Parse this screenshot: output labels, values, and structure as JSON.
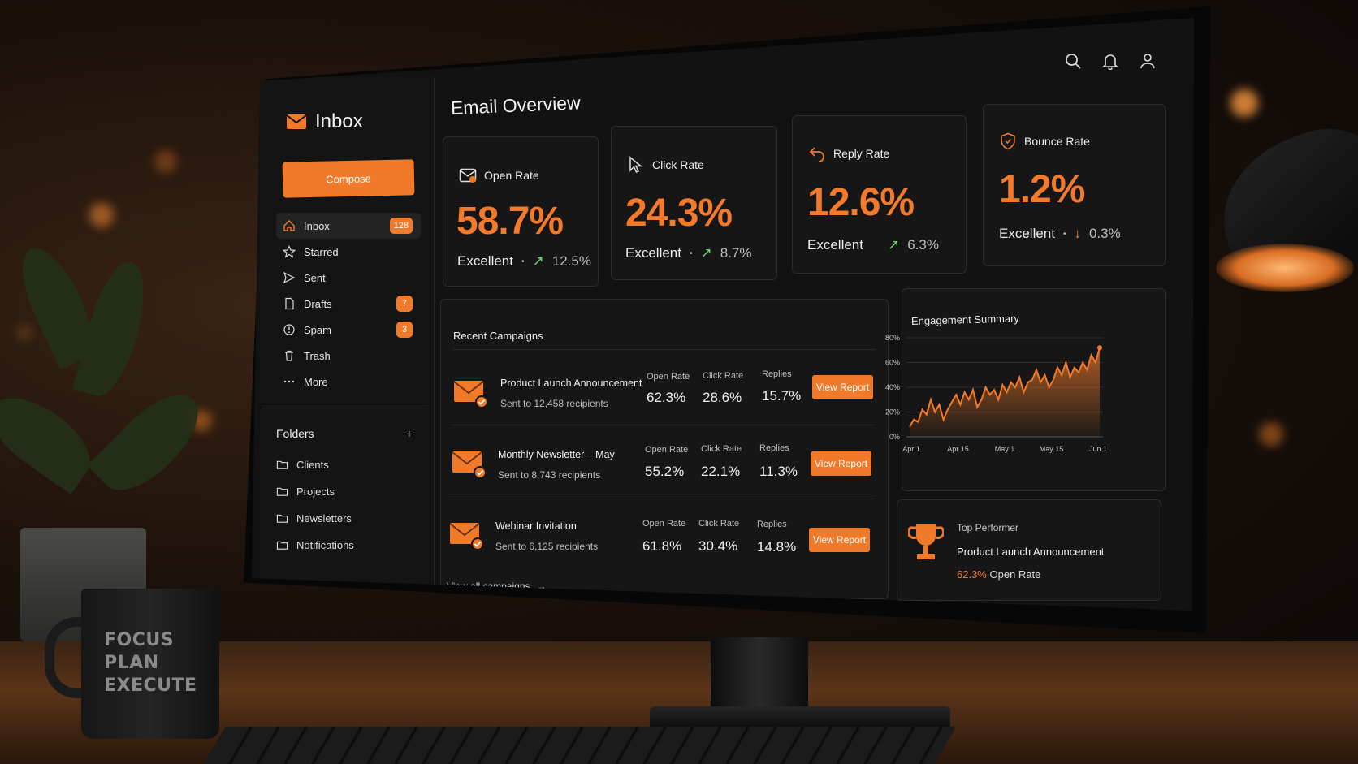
{
  "sidebar": {
    "title": "Inbox",
    "compose_label": "Compose",
    "nav": [
      {
        "label": "Inbox",
        "icon": "home-icon",
        "badge": "128"
      },
      {
        "label": "Starred",
        "icon": "star-icon",
        "badge": ""
      },
      {
        "label": "Sent",
        "icon": "send-icon",
        "badge": ""
      },
      {
        "label": "Drafts",
        "icon": "file-icon",
        "badge": "7"
      },
      {
        "label": "Spam",
        "icon": "alert-icon",
        "badge": "3"
      },
      {
        "label": "Trash",
        "icon": "trash-icon",
        "badge": ""
      },
      {
        "label": "More",
        "icon": "more-icon",
        "badge": ""
      }
    ],
    "folders_title": "Folders",
    "folders_add": "+",
    "folders": [
      "Clients",
      "Projects",
      "Newsletters",
      "Notifications"
    ]
  },
  "main": {
    "title": "Email Overview",
    "metrics": [
      {
        "label": "Open Rate",
        "icon": "mail-icon",
        "value": "58.7%",
        "status": "Excellent",
        "trend": "up",
        "delta": "12.5%"
      },
      {
        "label": "Click Rate",
        "icon": "cursor-icon",
        "value": "24.3%",
        "status": "Excellent",
        "trend": "up",
        "delta": "8.7%"
      },
      {
        "label": "Reply Rate",
        "icon": "reply-icon",
        "value": "12.6%",
        "status": "Excellent",
        "trend": "up",
        "delta": "6.3%"
      },
      {
        "label": "Bounce Rate",
        "icon": "shield-icon",
        "value": "1.2%",
        "status": "Excellent",
        "trend": "down",
        "delta": "0.3%"
      }
    ],
    "campaigns": {
      "title": "Recent Campaigns",
      "stat_headers": [
        "Open Rate",
        "Click Rate",
        "Replies"
      ],
      "button_label": "View Report",
      "rows": [
        {
          "name": "Product Launch Announcement",
          "sub": "Sent to 12,458 recipients",
          "open": "62.3%",
          "click": "28.6%",
          "replies": "15.7%"
        },
        {
          "name": "Monthly Newsletter – May",
          "sub": "Sent to 8,743 recipients",
          "open": "55.2%",
          "click": "22.1%",
          "replies": "11.3%"
        },
        {
          "name": "Webinar Invitation",
          "sub": "Sent to 6,125 recipients",
          "open": "61.8%",
          "click": "30.4%",
          "replies": "14.8%"
        }
      ],
      "view_all": "View all campaigns"
    },
    "engagement": {
      "title": "Engagement Summary"
    },
    "top_performer": {
      "label": "Top Performer",
      "name": "Product Launch Announcement",
      "rate_value": "62.3%",
      "rate_label": "Open Rate"
    }
  },
  "mug_text": [
    "FOCUS",
    "PLAN",
    "EXECUTE"
  ],
  "colors": {
    "accent": "#f07a2a",
    "positive": "#6fd469",
    "background": "#121212"
  },
  "chart_data": {
    "type": "area",
    "title": "Engagement Summary",
    "x_ticks": [
      "Apr 1",
      "Apr 15",
      "May 1",
      "May 15",
      "Jun 1"
    ],
    "y_ticks": [
      "0%",
      "20%",
      "40%",
      "60%",
      "80%"
    ],
    "ylim": [
      0,
      80
    ],
    "grid": true,
    "series": [
      {
        "values": [
          8,
          14,
          12,
          22,
          18,
          30,
          20,
          26,
          14,
          22,
          28,
          34,
          26,
          36,
          30,
          38,
          24,
          30,
          40,
          34,
          38,
          30,
          42,
          36,
          44,
          40,
          48,
          36,
          44,
          46,
          54,
          44,
          50,
          40,
          46,
          56,
          50,
          60,
          48,
          56,
          52,
          60,
          54,
          66,
          60,
          72
        ]
      }
    ]
  }
}
